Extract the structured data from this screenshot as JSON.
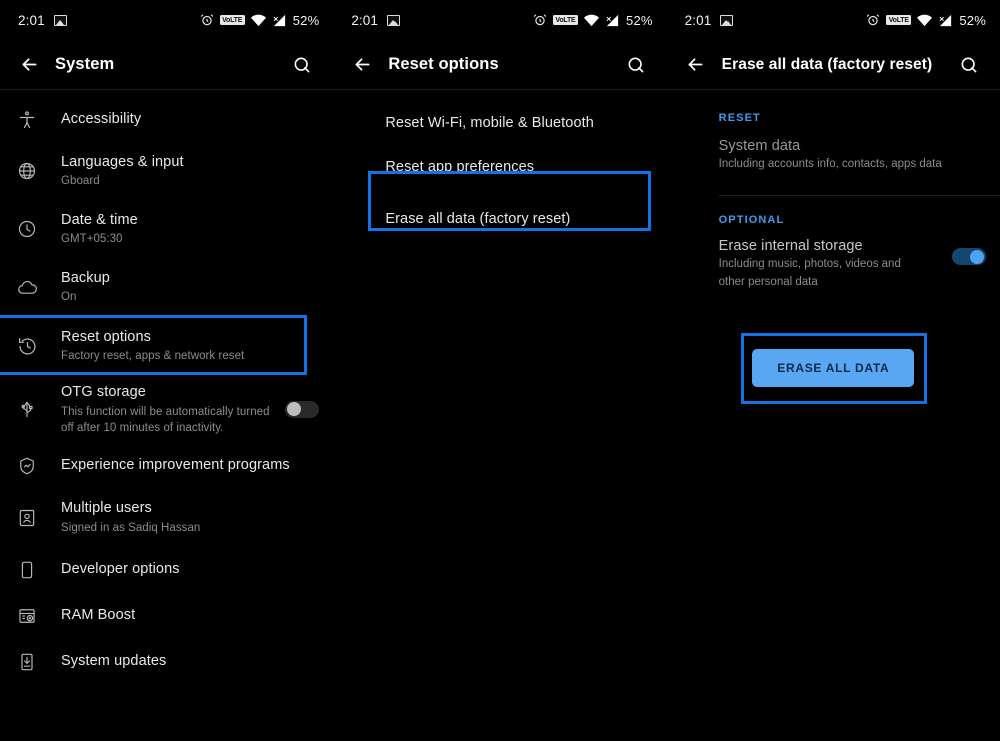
{
  "statusbar": {
    "time": "2:01",
    "photo_icon": "photo-icon",
    "alarm_icon": "alarm-icon",
    "volte_label": "VoLTE",
    "wifi_icon": "wifi-icon",
    "signal_icon": "signal-icon",
    "battery": "52%"
  },
  "panel1": {
    "title": "System",
    "back_icon": "back-arrow-icon",
    "search_icon": "search-icon",
    "items": [
      {
        "icon": "accessibility-icon",
        "title": "Accessibility",
        "sub": ""
      },
      {
        "icon": "globe-icon",
        "title": "Languages & input",
        "sub": "Gboard"
      },
      {
        "icon": "clock-icon",
        "title": "Date & time",
        "sub": "GMT+05:30"
      },
      {
        "icon": "cloud-icon",
        "title": "Backup",
        "sub": "On"
      },
      {
        "icon": "restore-icon",
        "title": "Reset options",
        "sub": "Factory reset, apps & network reset"
      },
      {
        "icon": "usb-icon",
        "title": "OTG storage",
        "sub": "This function will be automatically turned off after 10 minutes of inactivity.",
        "toggle": "off"
      },
      {
        "icon": "shield-chart-icon",
        "title": "Experience improvement programs",
        "sub": ""
      },
      {
        "icon": "user-frame-icon",
        "title": "Multiple users",
        "sub": "Signed in as Sadiq Hassan"
      },
      {
        "icon": "phone-icon",
        "title": "Developer options",
        "sub": ""
      },
      {
        "icon": "ram-icon",
        "title": "RAM Boost",
        "sub": ""
      },
      {
        "icon": "update-icon",
        "title": "System updates",
        "sub": ""
      }
    ],
    "highlight_index": 4
  },
  "panel2": {
    "title": "Reset options",
    "back_icon": "back-arrow-icon",
    "search_icon": "search-icon",
    "options": [
      "Reset Wi-Fi, mobile & Bluetooth",
      "Reset app preferences",
      "Erase all data (factory reset)"
    ],
    "highlight_index": 2
  },
  "panel3": {
    "title": "Erase all data (factory reset)",
    "back_icon": "back-arrow-icon",
    "search_icon": "search-icon",
    "reset_section_label": "RESET",
    "reset_item_title": "System data",
    "reset_item_sub": "Including accounts info, contacts, apps data",
    "optional_section_label": "OPTIONAL",
    "optional_item_title": "Erase internal storage",
    "optional_item_sub": "Including music, photos, videos and other personal data",
    "optional_toggle": "on",
    "erase_button_label": "ERASE ALL DATA"
  },
  "colors": {
    "highlight_border": "#1273e6",
    "accent": "#3f9bf0",
    "button_bg": "#59a6f2",
    "button_text": "#0d2a4a",
    "toggle_on": "#4da3f0",
    "background": "#000000"
  }
}
